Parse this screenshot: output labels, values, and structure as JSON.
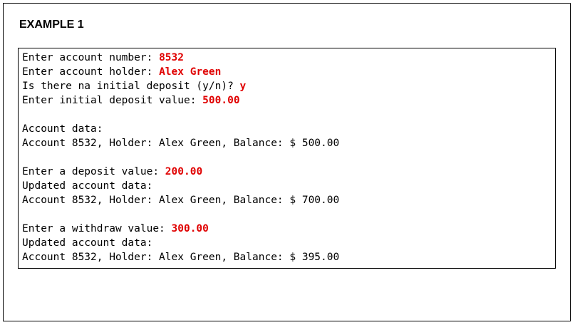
{
  "title": "EXAMPLE 1",
  "colors": {
    "input": "#e00000",
    "text": "#000000"
  },
  "console": {
    "lines": [
      {
        "prompt": "Enter account number: ",
        "input": "8532"
      },
      {
        "prompt": "Enter account holder: ",
        "input": "Alex Green"
      },
      {
        "prompt": "Is there na initial deposit (y/n)? ",
        "input": "y"
      },
      {
        "prompt": "Enter initial deposit value: ",
        "input": "500.00"
      },
      {
        "blank": true
      },
      {
        "prompt": "Account data:"
      },
      {
        "prompt": "Account 8532, Holder: Alex Green, Balance: $ 500.00"
      },
      {
        "blank": true
      },
      {
        "prompt": "Enter a deposit value: ",
        "input": "200.00"
      },
      {
        "prompt": "Updated account data:"
      },
      {
        "prompt": "Account 8532, Holder: Alex Green, Balance: $ 700.00"
      },
      {
        "blank": true
      },
      {
        "prompt": "Enter a withdraw value: ",
        "input": "300.00"
      },
      {
        "prompt": "Updated account data:"
      },
      {
        "prompt": "Account 8532, Holder: Alex Green, Balance: $ 395.00"
      }
    ]
  }
}
